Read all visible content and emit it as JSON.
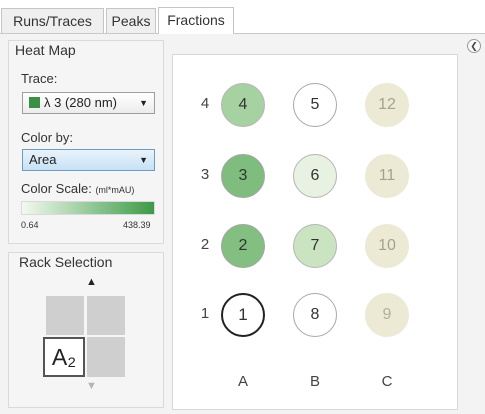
{
  "tabs": [
    {
      "label": "Runs/Traces",
      "active": false
    },
    {
      "label": "Peaks",
      "active": false
    },
    {
      "label": "Fractions",
      "active": true
    }
  ],
  "heatmap": {
    "title": "Heat Map",
    "trace_label": "Trace:",
    "trace_value": "λ 3 (280 nm)",
    "colorby_label": "Color by:",
    "colorby_value": "Area",
    "scale_label": "Color Scale:",
    "scale_unit": "(ml*mAU)",
    "scale_min": "0.64",
    "scale_max": "438.39",
    "scale_colors": {
      "low": "#f4f9f1",
      "high": "#3d9a47"
    }
  },
  "rack": {
    "title": "Rack Selection",
    "selected_label": "A₂",
    "up_icon": "arrow-up-icon",
    "down_icon": "arrow-down-icon"
  },
  "plate": {
    "row_labels": [
      "4",
      "3",
      "2",
      "1"
    ],
    "column_labels": [
      "A",
      "B",
      "C"
    ],
    "wells": [
      {
        "label": "4",
        "fill": "#a6d2a2",
        "border": "#b5b5b5",
        "text": "#333333"
      },
      {
        "label": "5",
        "fill": "#ffffff",
        "border": "#a8a8a8",
        "text": "#333333"
      },
      {
        "label": "12",
        "fill": "#ecead5",
        "border": "#ecead5",
        "text": "#a5a28c"
      },
      {
        "label": "3",
        "fill": "#7fbd7e",
        "border": "#a5a5a5",
        "text": "#333333"
      },
      {
        "label": "6",
        "fill": "#e7f2e2",
        "border": "#b5b5b5",
        "text": "#333333"
      },
      {
        "label": "11",
        "fill": "#ecead5",
        "border": "#ecead5",
        "text": "#a5a28c"
      },
      {
        "label": "2",
        "fill": "#82bf80",
        "border": "#a5a5a5",
        "text": "#333333"
      },
      {
        "label": "7",
        "fill": "#cae4c2",
        "border": "#b5b5b5",
        "text": "#333333"
      },
      {
        "label": "10",
        "fill": "#ecead5",
        "border": "#ecead5",
        "text": "#a5a28c"
      },
      {
        "label": "1",
        "fill": "#ffffff",
        "border": "#222222",
        "text": "#333333"
      },
      {
        "label": "8",
        "fill": "#ffffff",
        "border": "#a8a8a8",
        "text": "#333333"
      },
      {
        "label": "9",
        "fill": "#ecead5",
        "border": "#ecead5",
        "text": "#b3b09a"
      }
    ],
    "selected_well": "1"
  },
  "collapse_icon": "chevron-left-icon"
}
